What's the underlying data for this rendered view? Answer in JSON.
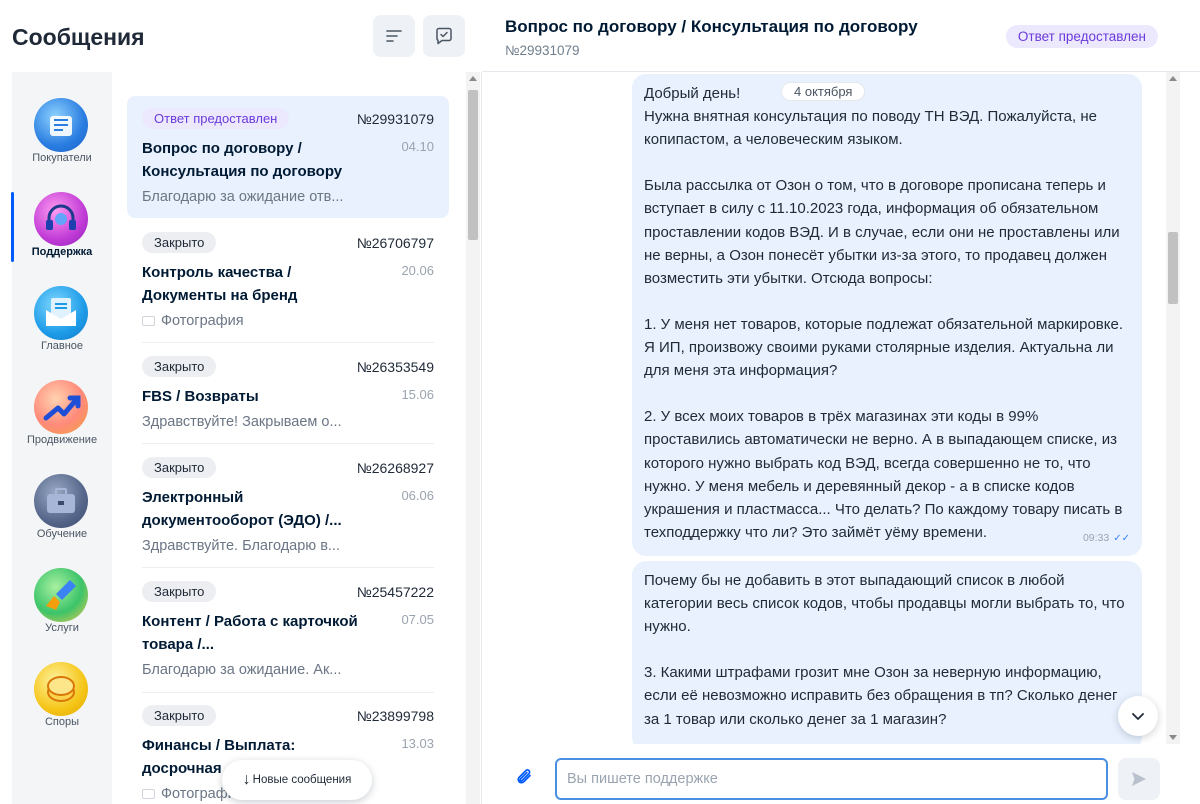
{
  "header": {
    "title": "Сообщения",
    "sort_icon": "sort-icon",
    "new_chat_icon": "chat-bubble-check-icon"
  },
  "rail": {
    "items": [
      {
        "label": "Покупатели",
        "icon": "buyers-icon",
        "active": false
      },
      {
        "label": "Поддержка",
        "icon": "headset-icon",
        "active": true
      },
      {
        "label": "Главное",
        "icon": "document-icon",
        "active": false
      },
      {
        "label": "Продвижение",
        "icon": "chart-up-icon",
        "active": false
      },
      {
        "label": "Обучение",
        "icon": "briefcase-icon",
        "active": false
      },
      {
        "label": "Услуги",
        "icon": "brush-icon",
        "active": false
      },
      {
        "label": "Споры",
        "icon": "coins-icon",
        "active": false
      }
    ]
  },
  "tickets": [
    {
      "status": "Ответ предоставлен",
      "number": "№29931079",
      "date": "04.10",
      "title": "Вопрос по договору / Консультация по договору",
      "preview": "Благодарю за ожидание отв...",
      "active": true
    },
    {
      "status": "Закрыто",
      "number": "№26706797",
      "date": "20.06",
      "title": "Контроль качества / Документы на бренд",
      "preview": "Фотография",
      "active": false
    },
    {
      "status": "Закрыто",
      "number": "№26353549",
      "date": "15.06",
      "title": "FBS / Возвраты",
      "preview": "Здравствуйте! Закрываем о...",
      "active": false
    },
    {
      "status": "Закрыто",
      "number": "№26268927",
      "date": "06.06",
      "title": "Электронный документооборот (ЭДО) /...",
      "preview": "Здравствуйте. Благодарю в...",
      "active": false
    },
    {
      "status": "Закрыто",
      "number": "№25457222",
      "date": "07.05",
      "title": "Контент / Работа с карточкой товара /...",
      "preview": "Благодарю за ожидание. Ак...",
      "active": false
    },
    {
      "status": "Закрыто",
      "number": "№23899798",
      "date": "13.03",
      "title": "Финансы / Выплата: досрочная",
      "preview": "Фотография",
      "active": false
    }
  ],
  "new_messages_label": "Новые сообщения",
  "chat": {
    "title": "Вопрос по договору / Консультация по договору",
    "number": "№29931079",
    "status": "Ответ предоставлен",
    "date_chip": "4 октября",
    "messages": [
      {
        "time": "09:33",
        "paragraphs": [
          "Добрый день!",
          "Нужна внятная консультация по поводу ТН ВЭД. Пожалуйста, не копипастом, а человеческим языком.",
          "",
          "Была рассылка от Озон о том, что в договоре прописана теперь и вступает в силу с 11.10.2023 года, информация об обязательном проставлении кодов ВЭД. И в случае, если они не проставлены или не верны, а Озон понесёт убытки из-за этого, то продавец должен возместить эти убытки. Отсюда вопросы:",
          "",
          "1. У меня нет товаров, которые подлежат обязательной маркировке. Я ИП, произвожу своими руками столярные изделия. Актуальна ли для меня эта информация?",
          "",
          "2. У всех моих товаров в трёх магазинах эти коды в 99% проставились автоматически не верно. А в выпадающем списке, из которого нужно выбрать код ВЭД, всегда совершенно не то, что нужно. У меня мебель и деревянный декор - а в списке кодов украшения и пластмасса... Что делать? По каждому товару писать в техподдержку что ли? Это займёт уёму времени."
        ]
      },
      {
        "time": "",
        "paragraphs": [
          "Почему бы не добавить в этот выпадающий список в любой категории весь список кодов, чтобы продавцы могли выбрать то, что нужно.",
          "",
          "3. Какими штрафами грозит мне Озон за неверную информацию, если её невозможно исправить без обращения в тп? Сколько денег за 1 товар или сколько денег за 1 магазин?"
        ]
      }
    ]
  },
  "composer": {
    "placeholder": "Вы пишете поддержке",
    "attach_icon": "paperclip-icon",
    "send_icon": "send-icon"
  },
  "colors": {
    "accent": "#005bff",
    "answered_badge_bg": "#ece8fe",
    "answered_badge_text": "#6b3bdb",
    "bubble_bg": "#e8f1fd"
  }
}
